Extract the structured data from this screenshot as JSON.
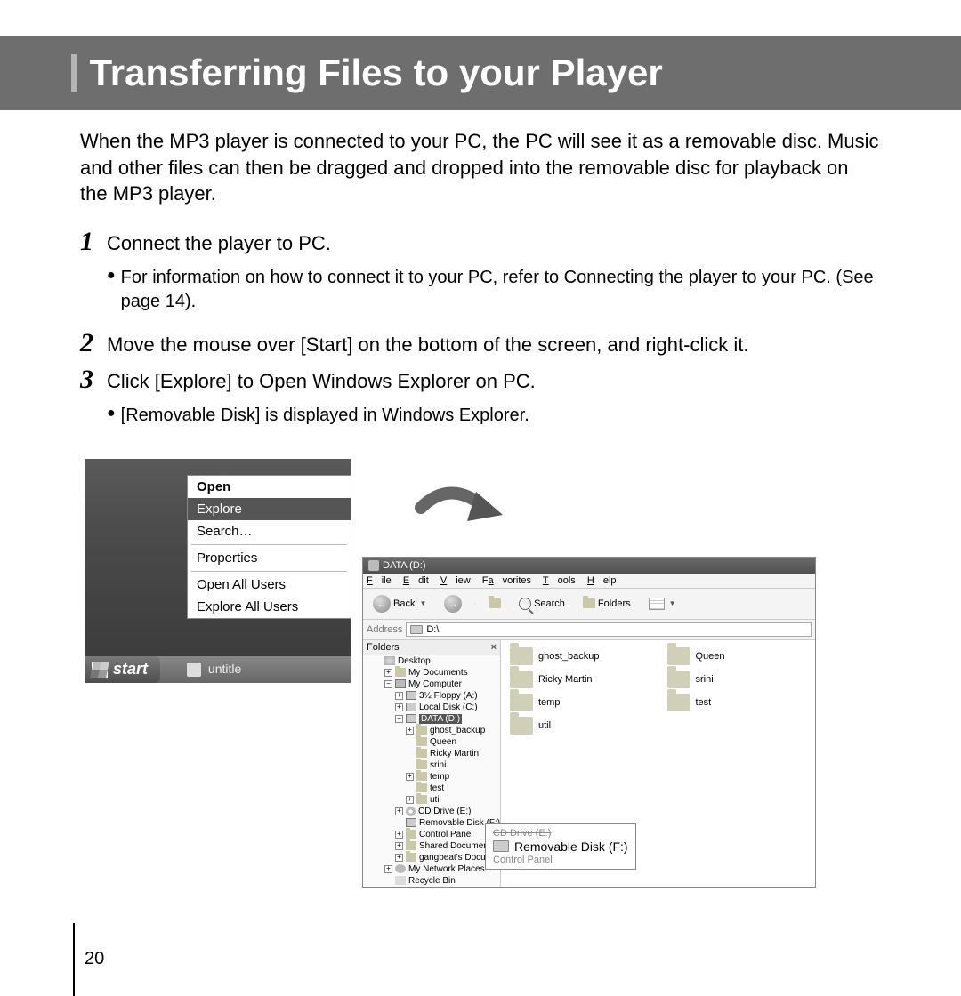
{
  "page": {
    "title": "Transferring Files to your Player",
    "intro": "When the MP3 player is connected to your PC, the PC will see it as a removable disc. Music and other files can then be dragged and dropped into the removable disc for playback on the MP3 player.",
    "page_number": "20"
  },
  "steps": {
    "s1": {
      "num": "1",
      "text": "Connect the player to PC."
    },
    "s1_bullet": "For information on how to connect it to your PC, refer to Connecting the player to your PC. (See page 14).",
    "s2": {
      "num": "2",
      "text": "Move the mouse over [Start] on the bottom of the screen, and right-click it."
    },
    "s3": {
      "num": "3",
      "text": "Click [Explore] to Open Windows Explorer on PC."
    },
    "s3_bullet": "[Removable Disk] is displayed in Windows Explorer."
  },
  "context_menu": {
    "open": "Open",
    "explore": "Explore",
    "search": "Search…",
    "properties": "Properties",
    "open_all": "Open All Users",
    "explore_all": "Explore All Users"
  },
  "taskbar": {
    "start": "start",
    "task1": "untitle"
  },
  "explorer": {
    "title": "DATA (D:)",
    "menu": {
      "file": "File",
      "edit": "Edit",
      "view": "View",
      "favorites": "Favorites",
      "tools": "Tools",
      "help": "Help"
    },
    "toolbar": {
      "back": "Back",
      "search": "Search",
      "folders": "Folders"
    },
    "address_label": "Address",
    "address_value": "D:\\",
    "tree_header": "Folders",
    "tree": {
      "desktop": "Desktop",
      "mydocs": "My Documents",
      "mycomp": "My Computer",
      "floppy": "3½ Floppy (A:)",
      "localc": "Local Disk (C:)",
      "datad": "DATA (D:)",
      "ghost": "ghost_backup",
      "queen": "Queen",
      "ricky": "Ricky Martin",
      "srini": "srini",
      "temp": "temp",
      "test": "test",
      "util": "util",
      "cddrive": "CD Drive (E:)",
      "removable": "Removable Disk (F:)",
      "cpanel": "Control Panel",
      "shared": "Shared Documents",
      "gangbeat": "gangbeat's Documents",
      "netplaces": "My Network Places",
      "recycle": "Recycle Bin"
    },
    "folders": {
      "f1": "ghost_backup",
      "f2": "Queen",
      "f3": "Ricky Martin",
      "f4": "srini",
      "f5": "temp",
      "f6": "test",
      "f7": "util"
    }
  },
  "callout": {
    "label": "Removable Disk (F:)",
    "above": "CD Drive (E:)",
    "below": "Control Panel"
  }
}
